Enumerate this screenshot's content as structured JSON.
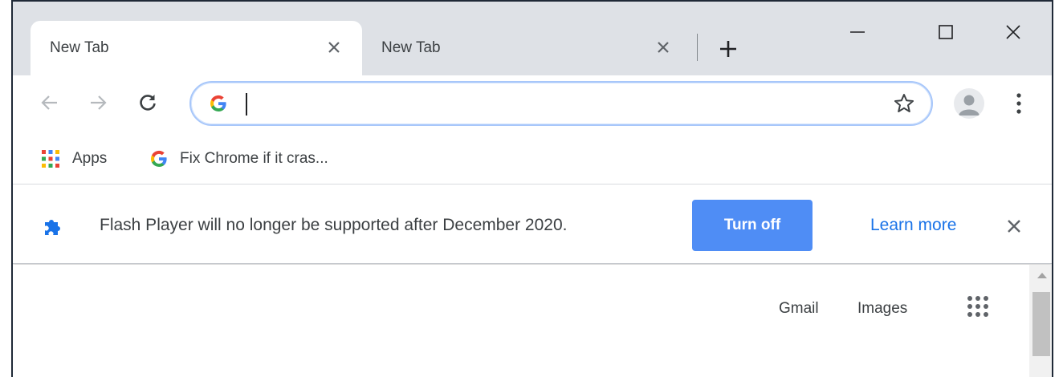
{
  "tabs": [
    {
      "label": "New Tab",
      "active": true
    },
    {
      "label": "New Tab",
      "active": false
    }
  ],
  "omnibox": {
    "value": "",
    "icon": "google-g-icon"
  },
  "bookmarks": [
    {
      "label": "Apps",
      "icon": "apps-grid-icon"
    },
    {
      "label": "Fix Chrome if it cras...",
      "icon": "google-g-icon"
    }
  ],
  "infobar": {
    "message": "Flash Player will no longer be supported after December 2020.",
    "primary_button": "Turn off",
    "link": "Learn more",
    "icon": "puzzle-icon"
  },
  "page": {
    "links": [
      "Gmail",
      "Images"
    ]
  },
  "colors": {
    "accent": "#4f8df5",
    "link": "#1a73e8",
    "tabstrip": "#dee1e6"
  }
}
